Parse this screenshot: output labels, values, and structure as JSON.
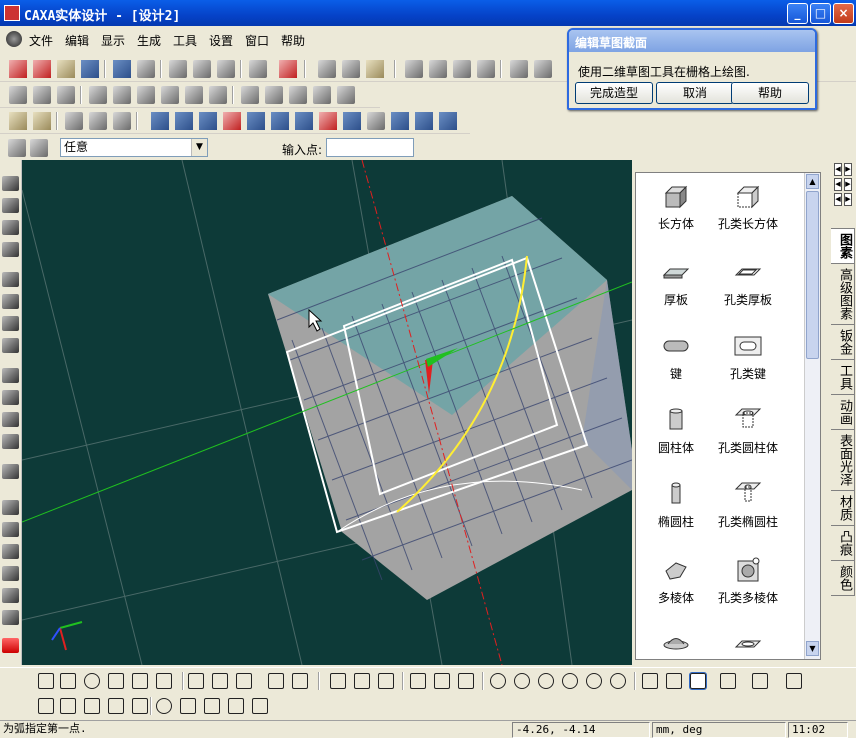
{
  "window": {
    "title": "CAXA实体设计 - [设计2]"
  },
  "menu": [
    "文件",
    "编辑",
    "显示",
    "生成",
    "工具",
    "设置",
    "窗口",
    "帮助"
  ],
  "input_row": {
    "filter_value": "任意",
    "input_label": "输入点:",
    "input_value": ""
  },
  "library": {
    "items": [
      {
        "label": "长方体",
        "icon": "box-icon"
      },
      {
        "label": "孔类长方体",
        "icon": "box-hole-icon"
      },
      {
        "label": "厚板",
        "icon": "thick-plate-icon"
      },
      {
        "label": "孔类厚板",
        "icon": "plate-hole-icon"
      },
      {
        "label": "键",
        "icon": "key-icon"
      },
      {
        "label": "孔类键",
        "icon": "key-hole-icon"
      },
      {
        "label": "圆柱体",
        "icon": "cylinder-icon"
      },
      {
        "label": "孔类圆柱体",
        "icon": "cylinder-hole-icon"
      },
      {
        "label": "椭圆柱",
        "icon": "elliptic-cylinder-icon"
      },
      {
        "label": "孔类椭圆柱",
        "icon": "elliptic-hole-icon"
      },
      {
        "label": "多棱体",
        "icon": "prism-icon"
      },
      {
        "label": "孔类多棱体",
        "icon": "prism-hole-icon"
      }
    ]
  },
  "side_tabs": [
    "图素",
    "高级图素",
    "钣金",
    "工具",
    "动画",
    "表面光泽",
    "材质",
    "凸痕",
    "颜色"
  ],
  "active_side_tab": "图素",
  "dialog": {
    "title": "编辑草图截面",
    "message": "使用二维草图工具在栅格上绘图.",
    "buttons": [
      "完成造型",
      "取消",
      "帮助"
    ]
  },
  "status": {
    "message": "为弧指定第一点.",
    "coords": "-4.26, -4.14",
    "units": "mm, deg",
    "time": "11:02"
  },
  "colors": {
    "viewport_bg": "#0d3a38",
    "title_bar": "#0542c8",
    "sketch_arc": "#ffee33",
    "axis_red": "#e02020",
    "axis_green": "#20c020"
  }
}
